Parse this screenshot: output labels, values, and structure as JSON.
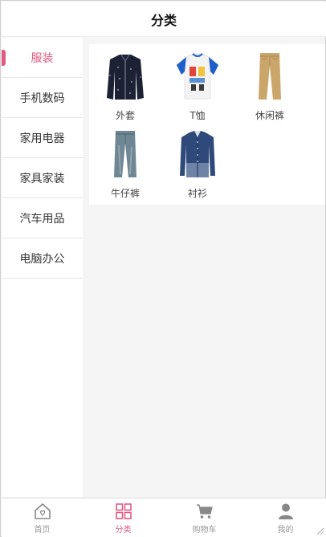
{
  "header": {
    "title": "分类"
  },
  "sidebar": {
    "items": [
      {
        "label": "服装",
        "active": true
      },
      {
        "label": "手机数码"
      },
      {
        "label": "家用电器"
      },
      {
        "label": "家具家装"
      },
      {
        "label": "汽车用品"
      },
      {
        "label": "电脑办公"
      }
    ]
  },
  "products": [
    {
      "label": "外套",
      "icon": "jacket-icon"
    },
    {
      "label": "T恤",
      "icon": "tshirt-icon"
    },
    {
      "label": "休闲裤",
      "icon": "khaki-pants-icon"
    },
    {
      "label": "牛仔裤",
      "icon": "jeans-icon"
    },
    {
      "label": "衬衫",
      "icon": "shirt-icon"
    }
  ],
  "tabbar": {
    "tabs": [
      {
        "label": "首页",
        "icon": "home-icon"
      },
      {
        "label": "分类",
        "icon": "category-grid-icon",
        "active": true
      },
      {
        "label": "购物车",
        "icon": "cart-icon"
      },
      {
        "label": "我的",
        "icon": "user-icon"
      }
    ]
  },
  "colors": {
    "accent": "#e05a83",
    "inactive": "#999999",
    "background": "#f5f5f5"
  }
}
